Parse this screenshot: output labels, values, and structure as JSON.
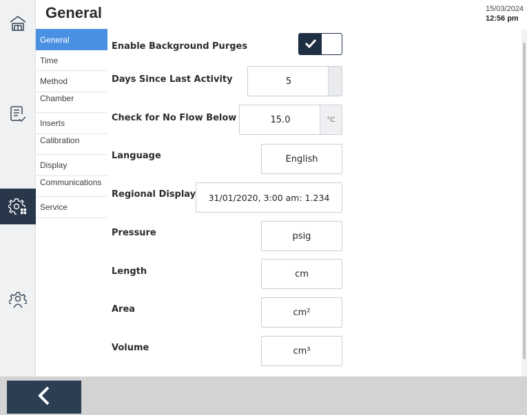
{
  "header": {
    "title": "General",
    "date": "15/03/2024",
    "time": "12:56 pm"
  },
  "rail": {
    "items": [
      {
        "icon": "home-icon",
        "active": false
      },
      {
        "icon": "checklist-icon",
        "active": false
      },
      {
        "icon": "settings-grid-icon",
        "active": true
      },
      {
        "icon": "user-settings-icon",
        "active": false
      }
    ]
  },
  "subnav": {
    "items": [
      {
        "label": "General",
        "active": true
      },
      {
        "label": "Time"
      },
      {
        "label": "Method"
      },
      {
        "label": "Chamber"
      },
      {
        "label": "Inserts"
      },
      {
        "label": "Calibration"
      },
      {
        "label": "Display"
      },
      {
        "label": "Communications"
      },
      {
        "label": "Service"
      }
    ]
  },
  "form": {
    "purges": {
      "label": "Enable Background Purges",
      "enabled": true
    },
    "days": {
      "label": "Days Since Last Activity",
      "value": "5"
    },
    "noflow": {
      "label": "Check for No Flow Below",
      "value": "15.0",
      "unit": "°C"
    },
    "language": {
      "label": "Language",
      "value": "English"
    },
    "regional": {
      "label": "Regional Display",
      "value": "31/01/2020, 3:00 am: 1.234"
    },
    "pressure": {
      "label": "Pressure",
      "value": "psig"
    },
    "length": {
      "label": "Length",
      "value": "cm"
    },
    "area": {
      "label": "Area",
      "value": "cm²"
    },
    "volume": {
      "label": "Volume",
      "value": "cm³"
    }
  },
  "footer": {
    "back_icon": "chevron-left-icon"
  },
  "colors": {
    "accent": "#4a90e2",
    "dark": "#1e2f44",
    "rail_active": "#28384a"
  }
}
